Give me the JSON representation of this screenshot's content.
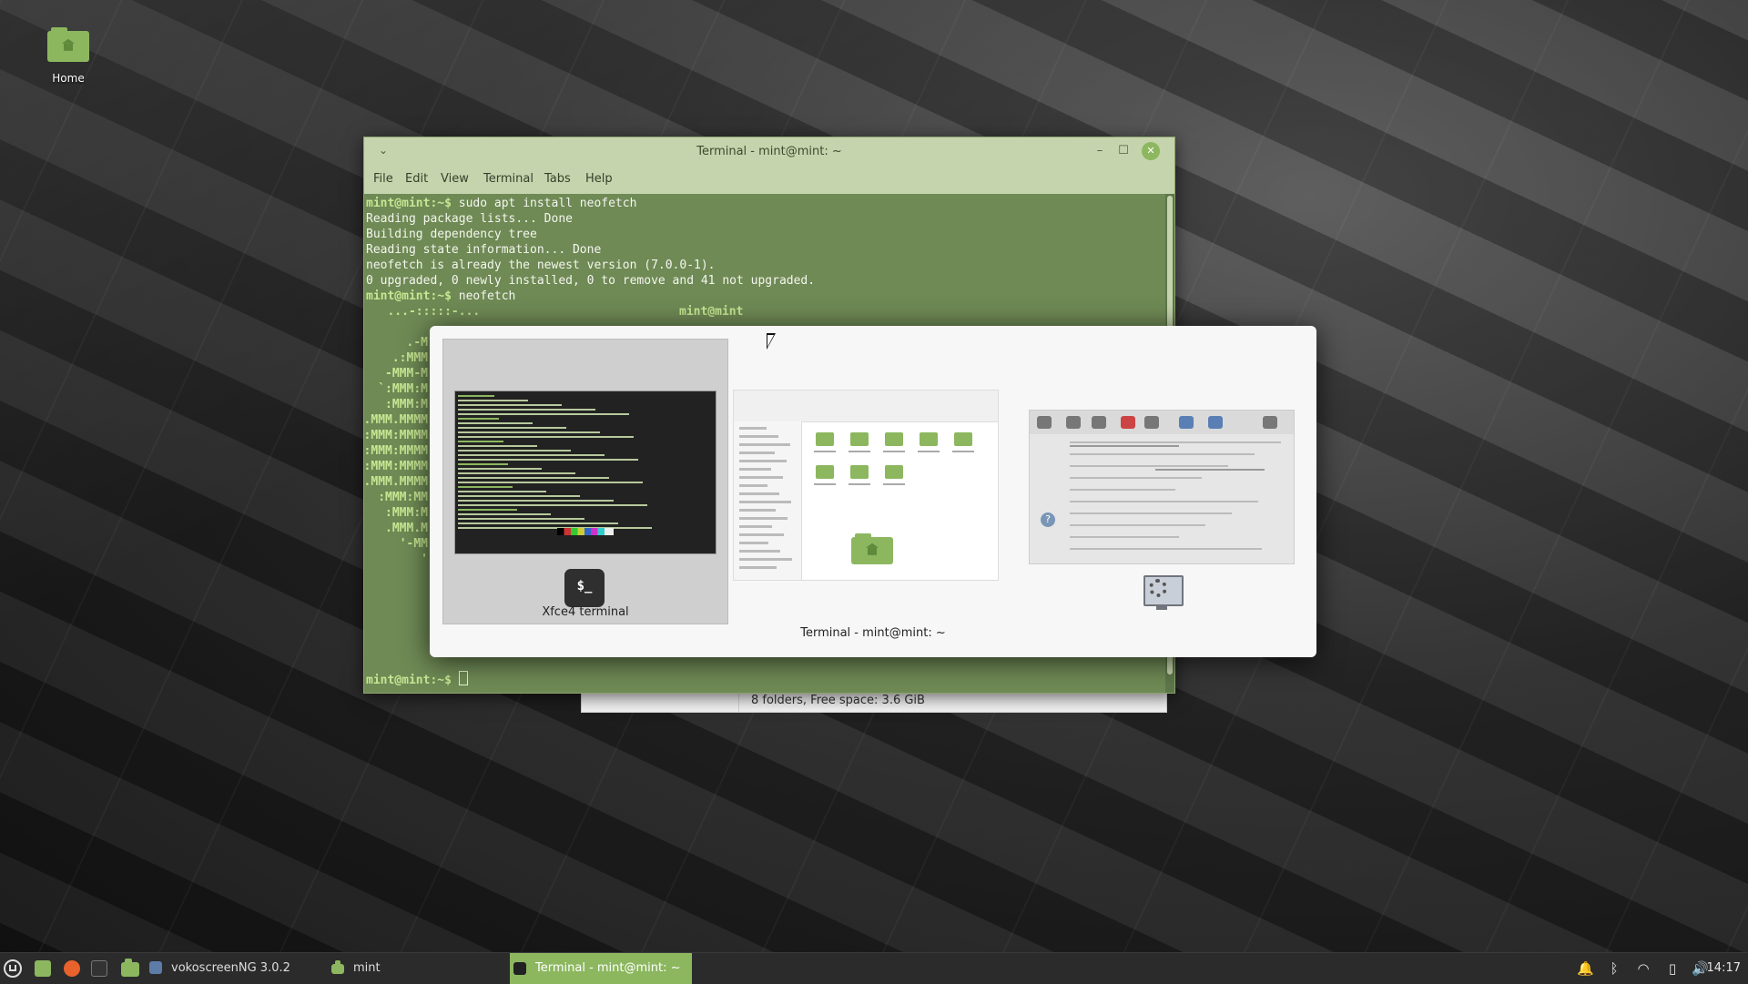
{
  "desktop": {
    "icons": [
      {
        "label": "Home",
        "icon": "home-folder-icon"
      }
    ]
  },
  "file_manager_status": {
    "text": "8 folders, Free space: 3.6 GiB"
  },
  "terminal": {
    "title": "Terminal - mint@mint: ~",
    "menu": [
      "File",
      "Edit",
      "View",
      "Terminal",
      "Tabs",
      "Help"
    ],
    "lines": [
      {
        "prompt": "mint@mint:~$",
        "text": " sudo apt install neofetch"
      },
      {
        "prompt": "",
        "text": "Reading package lists... Done"
      },
      {
        "prompt": "",
        "text": "Building dependency tree"
      },
      {
        "prompt": "",
        "text": "Reading state information... Done"
      },
      {
        "prompt": "",
        "text": "neofetch is already the newest version (7.0.0-1)."
      },
      {
        "prompt": "",
        "text": "0 upgraded, 0 newly installed, 0 to remove and 41 not upgraded."
      },
      {
        "prompt": "mint@mint:~$",
        "text": " neofetch"
      }
    ],
    "neofetch_user": "mint@mint",
    "neofetch_art_top": "   ...-:::::-...",
    "neofetch_art": [
      ".-M",
      ".:MMM",
      "-MMM-M",
      "`:MMM:M",
      ":MMM:M",
      ".MMM.MMMM",
      ":MMM:MMMM",
      ":MMM:MMMM",
      ":MMM:MMMM",
      ".MMM.MMMM",
      ":MMM:MM",
      ":MMM:M",
      ".MMM.M",
      "'-MM",
      "'"
    ],
    "final_prompt": "mint@mint:~$"
  },
  "switcher": {
    "items": [
      {
        "label": "Xfce4 terminal",
        "selected": true
      },
      {
        "label": "",
        "selected": false
      },
      {
        "label": "",
        "selected": false
      }
    ],
    "term_icon_text": "$_",
    "window_title": "Terminal - mint@mint: ~"
  },
  "taskbar": {
    "launchers": [
      "show-desktop-icon",
      "firefox-icon",
      "terminal-icon",
      "files-icon"
    ],
    "tasks": [
      {
        "label": "vokoscreenNG 3.0.2",
        "icon": "vokoscreen-icon"
      },
      {
        "label": "mint",
        "icon": "folder-icon"
      },
      {
        "label": "Terminal - mint@mint: ~",
        "icon": "terminal-icon",
        "active": true
      }
    ],
    "tray": [
      "notification-icon",
      "bluetooth-icon",
      "wifi-icon",
      "battery-icon",
      "volume-icon"
    ],
    "clock": "14:17"
  },
  "colors": {
    "accent": "#8cb75f",
    "terminal_bg": "#6f8a55",
    "titlebar": "#c5d4ad"
  }
}
